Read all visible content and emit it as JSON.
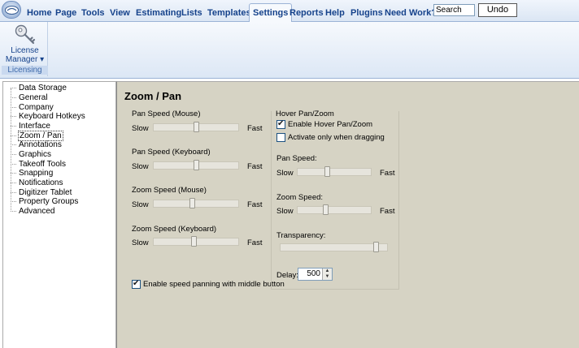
{
  "menu": {
    "tabs": [
      {
        "label": "Home"
      },
      {
        "label": "Page"
      },
      {
        "label": "Tools"
      },
      {
        "label": "View"
      },
      {
        "label": "Estimating"
      },
      {
        "label": "Lists"
      },
      {
        "label": "Templates"
      },
      {
        "label": "Settings"
      },
      {
        "label": "Reports"
      },
      {
        "label": "Help"
      },
      {
        "label": "Plugins"
      },
      {
        "label": "Need Work?"
      }
    ],
    "active_tab": "Settings",
    "search": {
      "value": "Search"
    },
    "undo_label": "Undo"
  },
  "ribbon": {
    "license_label_1": "License",
    "license_label_2": "Manager ▾",
    "group_label": "Licensing"
  },
  "tree": {
    "items": [
      {
        "label": "Data Storage"
      },
      {
        "label": "General"
      },
      {
        "label": "Company"
      },
      {
        "label": "Keyboard Hotkeys"
      },
      {
        "label": "Interface"
      },
      {
        "label": "Zoom / Pan"
      },
      {
        "label": "Annotations"
      },
      {
        "label": "Graphics"
      },
      {
        "label": "Takeoff Tools"
      },
      {
        "label": "Snapping"
      },
      {
        "label": "Notifications"
      },
      {
        "label": "Digitizer Tablet"
      },
      {
        "label": "Property Groups"
      },
      {
        "label": "Advanced"
      }
    ],
    "selected": "Zoom / Pan"
  },
  "panel": {
    "title": "Zoom / Pan",
    "slow": "Slow",
    "fast": "Fast",
    "sliders": [
      {
        "label": "Pan Speed (Mouse)",
        "value": 0.5
      },
      {
        "label": "Pan Speed (Keyboard)",
        "value": 0.5
      },
      {
        "label": "Zoom Speed (Mouse)",
        "value": 0.45
      },
      {
        "label": "Zoom Speed (Keyboard)",
        "value": 0.47
      }
    ],
    "middle_button": {
      "label": "Enable speed panning with middle button",
      "checked": true
    },
    "hover": {
      "title": "Hover Pan/Zoom",
      "enable": {
        "label": "Enable Hover Pan/Zoom",
        "checked": true
      },
      "drag_only": {
        "label": "Activate only when dragging",
        "checked": false
      },
      "pan_speed": {
        "label": "Pan Speed:",
        "value": 0.4
      },
      "zoom_speed": {
        "label": "Zoom Speed:",
        "value": 0.37
      },
      "transparency": {
        "label": "Transparency:",
        "value": 0.92
      },
      "delay": {
        "label": "Delay:",
        "value": "500"
      }
    }
  }
}
